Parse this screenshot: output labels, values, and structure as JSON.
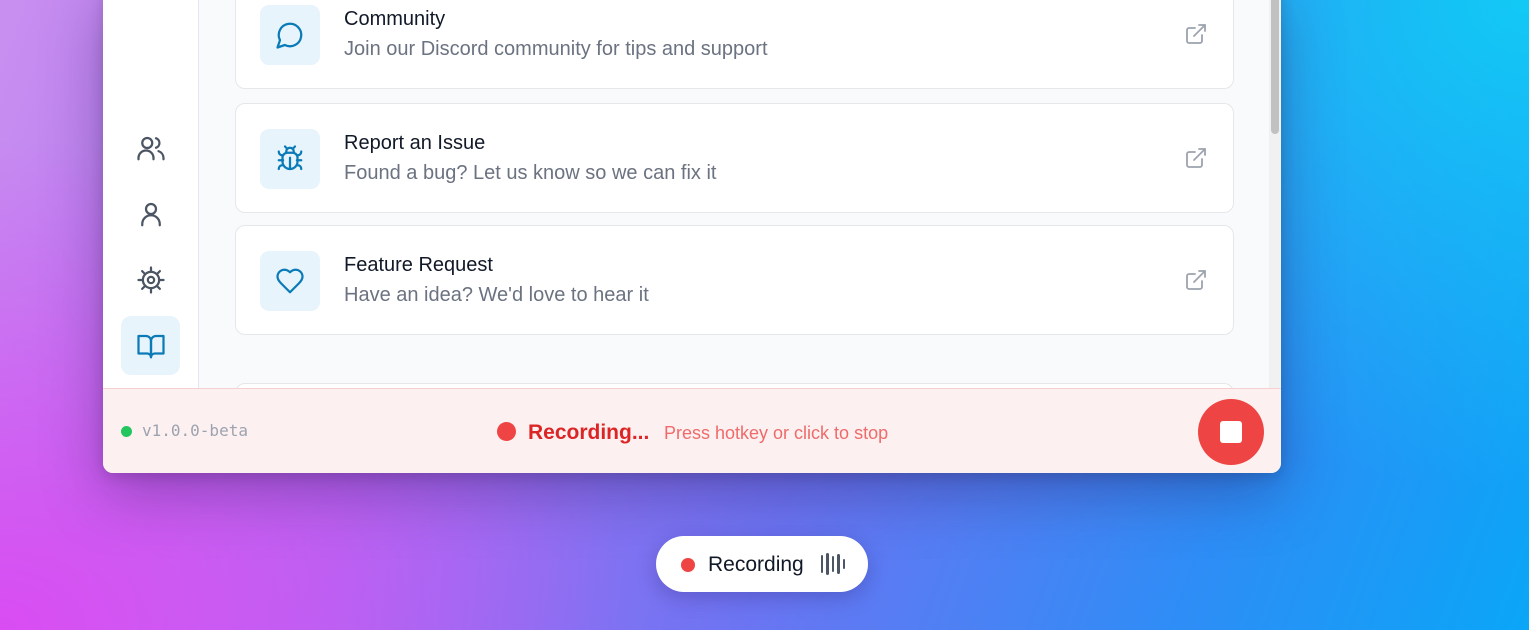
{
  "sidebar": {
    "items": [
      {
        "icon": "users-icon",
        "label": "Team"
      },
      {
        "icon": "user-icon",
        "label": "Profile"
      },
      {
        "icon": "settings-icon",
        "label": "Settings"
      },
      {
        "icon": "book-open-icon",
        "label": "Docs",
        "active": true
      }
    ]
  },
  "help_links": [
    {
      "icon": "message-circle-icon",
      "title": "Community",
      "description": "Join our Discord community for tips and support"
    },
    {
      "icon": "bug-icon",
      "title": "Report an Issue",
      "description": "Found a bug? Let us know so we can fix it"
    },
    {
      "icon": "heart-icon",
      "title": "Feature Request",
      "description": "Have an idea? We'd love to hear it"
    }
  ],
  "footer": {
    "version": "v1.0.0-beta",
    "recording_label": "Recording...",
    "recording_hint": "Press hotkey or click to stop"
  },
  "overlay": {
    "label": "Recording"
  },
  "colors": {
    "accent": "#0b7bb8",
    "recording_red": "#ef4444",
    "status_green": "#22c55e"
  }
}
